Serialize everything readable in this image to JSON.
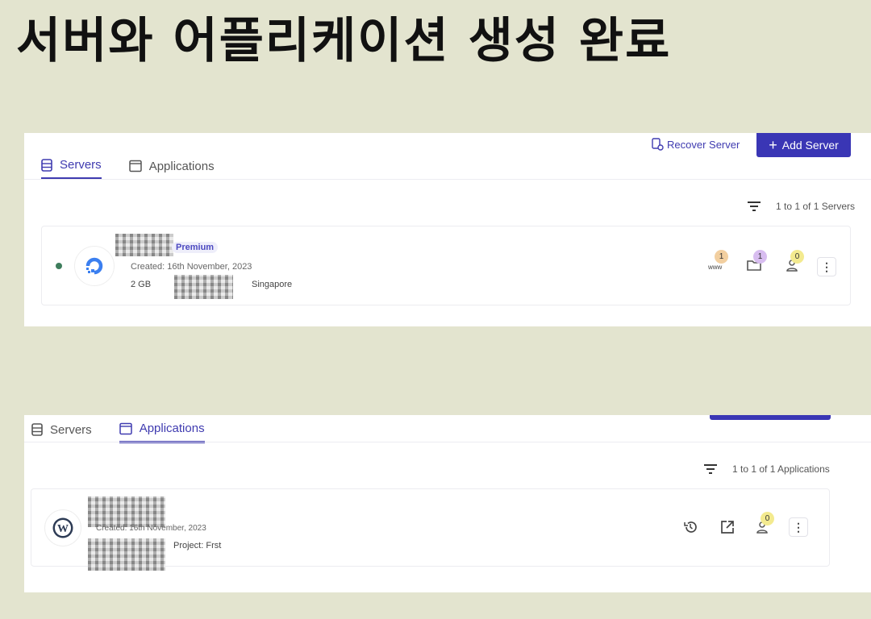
{
  "title": "서버와 어플리케이션 생성 완료",
  "servers_panel": {
    "tabs": [
      {
        "label": "Servers",
        "active": true
      },
      {
        "label": "Applications",
        "active": false
      }
    ],
    "recover_label": "Recover Server",
    "add_label": "Add Server",
    "count_text": "1 to 1 of 1 Servers",
    "server": {
      "status_color": "#3e7d5c",
      "tier": "Premium",
      "created": "Created: 16th November, 2023",
      "size": "2 GB",
      "region": "Singapore",
      "badges": {
        "domains": "1",
        "folders": "1",
        "users": "0"
      }
    }
  },
  "apps_panel": {
    "tabs": [
      {
        "label": "Servers",
        "active": false
      },
      {
        "label": "Applications",
        "active": true
      }
    ],
    "count_text": "1 to 1 of 1 Applications",
    "app": {
      "created": "Created: 16th November, 2023",
      "project": "Project: Frst",
      "badges": {
        "users": "0"
      }
    }
  },
  "colors": {
    "accent": "#3f3bb0",
    "background": "#e3e4cf"
  }
}
